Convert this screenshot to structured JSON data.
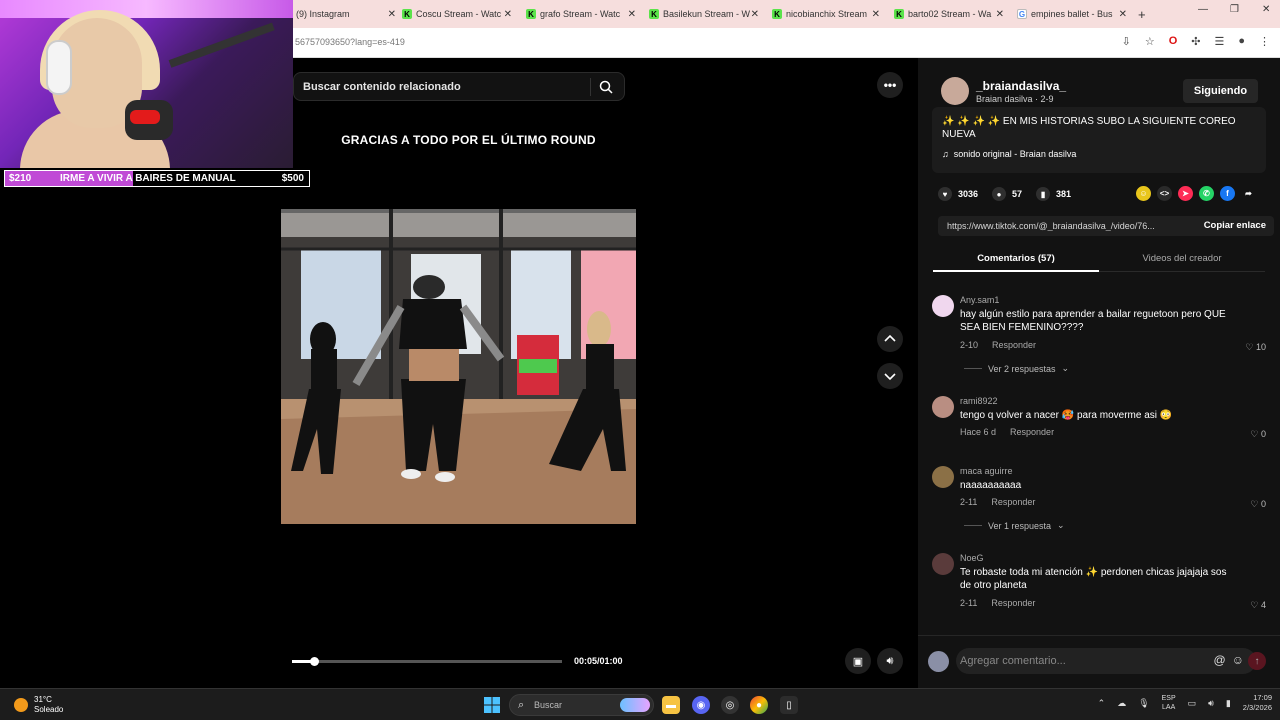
{
  "browser": {
    "tabs": [
      {
        "label": "(9) Instagram",
        "icon": "instagram-icon"
      },
      {
        "label": "Coscu Stream - Watc",
        "icon": "kick-icon"
      },
      {
        "label": "grafo Stream - Watc",
        "icon": "kick-icon"
      },
      {
        "label": "Basilekun Stream - W",
        "icon": "kick-icon"
      },
      {
        "label": "nicobianchix Stream",
        "icon": "kick-icon"
      },
      {
        "label": "barto02 Stream - Wa",
        "icon": "kick-icon"
      },
      {
        "label": "empines ballet - Bus",
        "icon": "google-icon"
      }
    ],
    "new_tab": "+",
    "url": "56757093650?lang=es-419"
  },
  "overlay": {
    "goal_amount_left": "$210",
    "goal_text": "IRME A VIVIR A BAIRES DE MANUAL",
    "goal_amount_right": "$500",
    "goal_progress": 0.42
  },
  "video": {
    "search_placeholder": "Buscar contenido relacionado",
    "title": "GRACIAS A TODO POR EL ÚLTIMO ROUND",
    "time": "00:05/01:00",
    "progress": 0.083
  },
  "creator": {
    "username": "_braiandasilva_",
    "subline": "Braian dasilva · 2-9",
    "follow_label": "Siguiendo",
    "description": "✨ ✨ ✨ ✨ EN MIS HISTORIAS SUBO LA SIGUIENTE COREO NUEVA",
    "sound": "sonido original - Braian dasilva"
  },
  "stats": {
    "likes": "3036",
    "comments": "57",
    "saves": "381"
  },
  "link": {
    "url": "https://www.tiktok.com/@_braiandasilva_/video/76...",
    "copy_label": "Copiar enlace"
  },
  "panel_tabs": {
    "comments": "Comentarios (57)",
    "creator_videos": "Videos del creador"
  },
  "comments": [
    {
      "user": "Any.sam1",
      "text": "hay algún estilo para aprender a bailar reguetoon pero QUE SEA BIEN FEMENINO????",
      "date": "2-10",
      "reply": "Responder",
      "likes": "10",
      "more": "Ver 2 respuestas"
    },
    {
      "user": "rami8922",
      "text": "tengo q volver a nacer 🥵 para moverme asi 😳",
      "date": "Hace 6 d",
      "reply": "Responder",
      "likes": "0",
      "more": ""
    },
    {
      "user": "maca aguirre",
      "text": "naaaaaaaaaa",
      "date": "2-11",
      "reply": "Responder",
      "likes": "0",
      "more": "Ver 1 respuesta"
    },
    {
      "user": "NoeG",
      "text": "Te robaste toda mi atención ✨ perdonen chicas jajajaja sos de otro planeta",
      "date": "2-11",
      "reply": "Responder",
      "likes": "4",
      "more": ""
    }
  ],
  "comment_input": {
    "placeholder": "Agregar comentario..."
  },
  "taskbar": {
    "temp": "31°C",
    "weather": "Soleado",
    "search": "Buscar",
    "lang1": "ESP",
    "lang2": "LAA",
    "time": "17:09",
    "date": "2/3/2026"
  }
}
